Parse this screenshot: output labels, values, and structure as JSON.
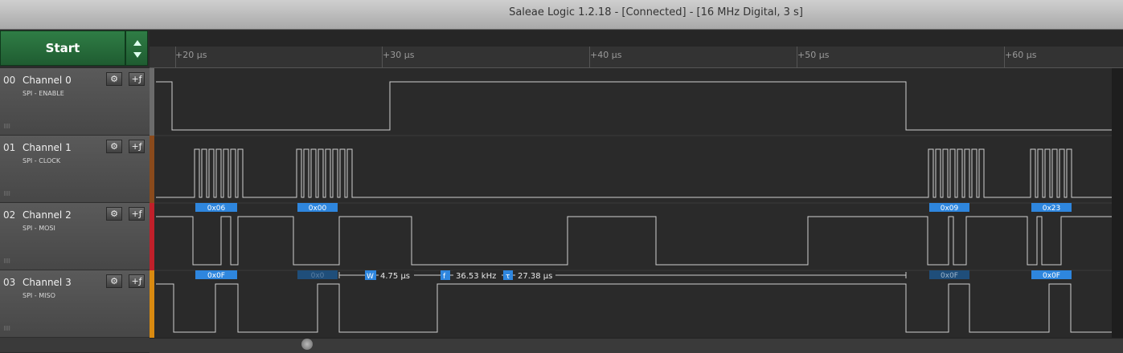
{
  "window": {
    "title": "Saleae Logic 1.2.18 - [Connected] - [16 MHz Digital, 3 s]"
  },
  "controls": {
    "start_label": "Start"
  },
  "ruler": {
    "ticks": [
      "+20 µs",
      "+30 µs",
      "+40 µs",
      "+50 µs",
      "+60 µs"
    ]
  },
  "channels": [
    {
      "num": "00",
      "name": "Channel 0",
      "analyzer": "SPI - ENABLE",
      "color": "#6b6b6b"
    },
    {
      "num": "01",
      "name": "Channel 1",
      "analyzer": "SPI - CLOCK",
      "color": "#8a4a1c"
    },
    {
      "num": "02",
      "name": "Channel 2",
      "analyzer": "SPI - MOSI",
      "color": "#c0202a"
    },
    {
      "num": "03",
      "name": "Channel 3",
      "analyzer": "SPI - MISO",
      "color": "#d98a10"
    }
  ],
  "decodes": {
    "clock": [
      "0x06",
      "0x00",
      "0x09",
      "0x23"
    ],
    "mosi": [
      "0x0F",
      "0x0",
      "0x0F",
      "0x0F"
    ]
  },
  "measurement": {
    "width": "4.75 µs",
    "frequency": "36.53 kHz",
    "period": "27.38 µs",
    "w_icon": "W",
    "f_icon": "f",
    "t_icon": "τ"
  },
  "accent": "#2e86de"
}
